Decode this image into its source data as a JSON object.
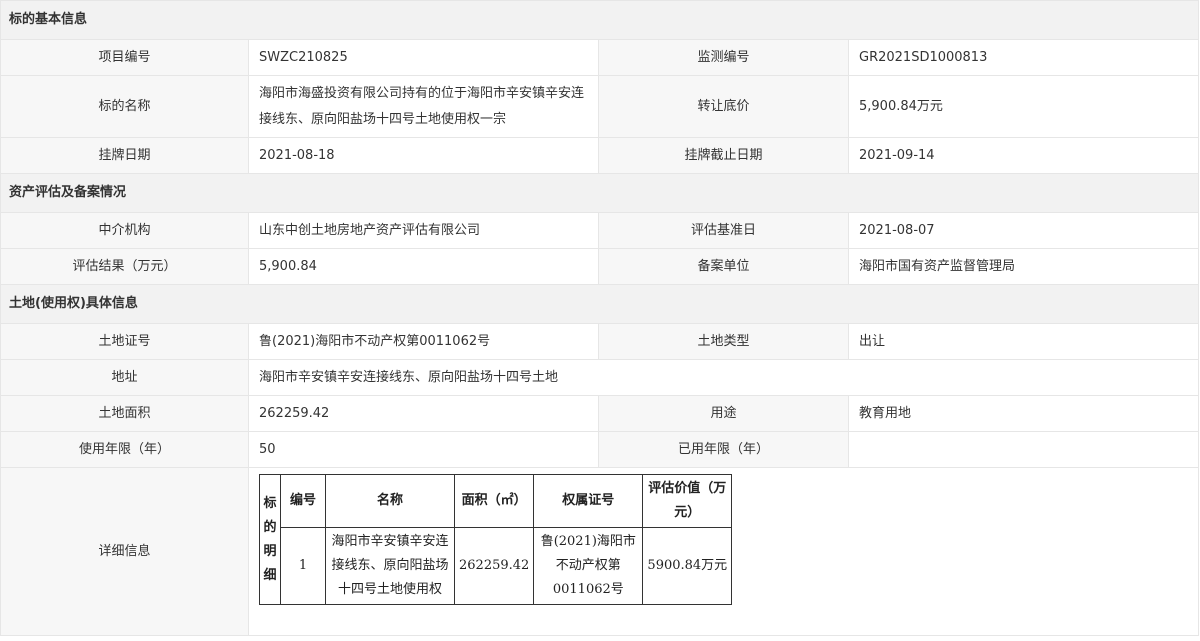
{
  "sections": {
    "basic": "标的基本信息",
    "assessment": "资产评估及备案情况",
    "land": "土地(使用权)具体信息"
  },
  "basic": {
    "project_no_label": "项目编号",
    "project_no": "SWZC210825",
    "monitor_no_label": "监测编号",
    "monitor_no": "GR2021SD1000813",
    "name_label": "标的名称",
    "name": "海阳市海盛投资有限公司持有的位于海阳市辛安镇辛安连接线东、原向阳盐场十四号土地使用权一宗",
    "reserve_price_label": "转让底价",
    "reserve_price": "5,900.84万元",
    "listing_date_label": "挂牌日期",
    "listing_date": "2021-08-18",
    "listing_end_label": "挂牌截止日期",
    "listing_end": "2021-09-14"
  },
  "assessment": {
    "agency_label": "中介机构",
    "agency": "山东中创土地房地产资产评估有限公司",
    "base_date_label": "评估基准日",
    "base_date": "2021-08-07",
    "result_label": "评估结果（万元）",
    "result": "5,900.84",
    "filing_unit_label": "备案单位",
    "filing_unit": "海阳市国有资产监督管理局"
  },
  "land": {
    "cert_label": "土地证号",
    "cert": "鲁(2021)海阳市不动产权第0011062号",
    "type_label": "土地类型",
    "type": "出让",
    "address_label": "地址",
    "address": "海阳市辛安镇辛安连接线东、原向阳盐场十四号土地",
    "area_label": "土地面积",
    "area": "262259.42",
    "usage_label": "用途",
    "usage": "教育用地",
    "years_label": "使用年限（年）",
    "years": "50",
    "used_years_label": "已用年限（年）",
    "used_years": "",
    "detail_label": "详细信息"
  },
  "detail_table": {
    "side_label": "标的明细",
    "headers": {
      "no": "编号",
      "name": "名称",
      "area": "面积（㎡）",
      "cert": "权属证号",
      "value": "评估价值（万元）"
    },
    "rows": [
      {
        "no": "1",
        "name": "海阳市辛安镇辛安连接线东、原向阳盐场十四号土地使用权",
        "area": "262259.42",
        "cert": "鲁(2021)海阳市不动产权第0011062号",
        "value": "5900.84万元"
      }
    ]
  }
}
